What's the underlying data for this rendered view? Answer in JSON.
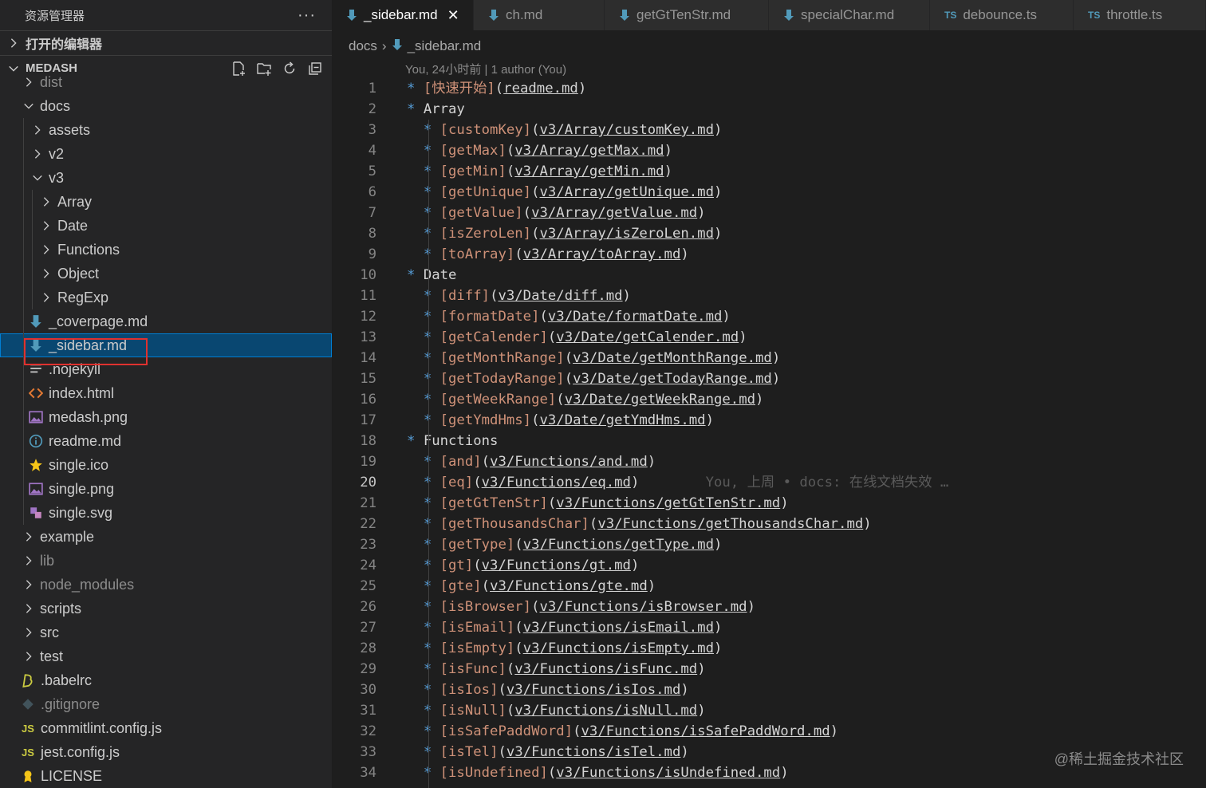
{
  "explorer": {
    "title": "资源管理器",
    "more": "···",
    "open_editors_label": "打开的编辑器",
    "project_label": "MEDASH"
  },
  "tree": [
    {
      "label": "dist",
      "type": "folder",
      "depth": 1,
      "expanded": false,
      "dim": true,
      "icon": "chevron-right-icon"
    },
    {
      "label": "docs",
      "type": "folder",
      "depth": 1,
      "expanded": true,
      "icon": "chevron-down-icon"
    },
    {
      "label": "assets",
      "type": "folder",
      "depth": 2,
      "expanded": false,
      "icon": "chevron-right-icon"
    },
    {
      "label": "v2",
      "type": "folder",
      "depth": 2,
      "expanded": false,
      "icon": "chevron-right-icon"
    },
    {
      "label": "v3",
      "type": "folder",
      "depth": 2,
      "expanded": true,
      "icon": "chevron-down-icon"
    },
    {
      "label": "Array",
      "type": "folder",
      "depth": 3,
      "expanded": false,
      "icon": "chevron-right-icon"
    },
    {
      "label": "Date",
      "type": "folder",
      "depth": 3,
      "expanded": false,
      "icon": "chevron-right-icon"
    },
    {
      "label": "Functions",
      "type": "folder",
      "depth": 3,
      "expanded": false,
      "icon": "chevron-right-icon"
    },
    {
      "label": "Object",
      "type": "folder",
      "depth": 3,
      "expanded": false,
      "icon": "chevron-right-icon"
    },
    {
      "label": "RegExp",
      "type": "folder",
      "depth": 3,
      "expanded": false,
      "icon": "chevron-right-icon"
    },
    {
      "label": "_coverpage.md",
      "type": "file",
      "depth": 2,
      "icon": "markdown-icon"
    },
    {
      "label": "_sidebar.md",
      "type": "file",
      "depth": 2,
      "icon": "markdown-icon",
      "selected": true
    },
    {
      "label": ".nojekyll",
      "type": "file",
      "depth": 2,
      "icon": "text-file-icon"
    },
    {
      "label": "index.html",
      "type": "file",
      "depth": 2,
      "icon": "html-icon"
    },
    {
      "label": "medash.png",
      "type": "file",
      "depth": 2,
      "icon": "image-icon"
    },
    {
      "label": "readme.md",
      "type": "file",
      "depth": 2,
      "icon": "info-icon"
    },
    {
      "label": "single.ico",
      "type": "file",
      "depth": 2,
      "icon": "star-icon"
    },
    {
      "label": "single.png",
      "type": "file",
      "depth": 2,
      "icon": "image-icon"
    },
    {
      "label": "single.svg",
      "type": "file",
      "depth": 2,
      "icon": "svg-icon"
    },
    {
      "label": "example",
      "type": "folder",
      "depth": 1,
      "expanded": false,
      "icon": "chevron-right-icon"
    },
    {
      "label": "lib",
      "type": "folder",
      "depth": 1,
      "expanded": false,
      "dim": true,
      "icon": "chevron-right-icon"
    },
    {
      "label": "node_modules",
      "type": "folder",
      "depth": 1,
      "expanded": false,
      "dim": true,
      "icon": "chevron-right-icon"
    },
    {
      "label": "scripts",
      "type": "folder",
      "depth": 1,
      "expanded": false,
      "icon": "chevron-right-icon"
    },
    {
      "label": "src",
      "type": "folder",
      "depth": 1,
      "expanded": false,
      "icon": "chevron-right-icon"
    },
    {
      "label": "test",
      "type": "folder",
      "depth": 1,
      "expanded": false,
      "icon": "chevron-right-icon"
    },
    {
      "label": ".babelrc",
      "type": "file",
      "depth": 0,
      "icon": "babel-icon"
    },
    {
      "label": ".gitignore",
      "type": "file",
      "depth": 0,
      "dim": true,
      "icon": "git-icon"
    },
    {
      "label": "commitlint.config.js",
      "type": "file",
      "depth": 0,
      "icon": "js-icon"
    },
    {
      "label": "jest.config.js",
      "type": "file",
      "depth": 0,
      "icon": "js-icon"
    },
    {
      "label": "LICENSE",
      "type": "file",
      "depth": 0,
      "icon": "license-icon"
    }
  ],
  "tabs": [
    {
      "label": "_sidebar.md",
      "icon": "markdown-icon",
      "active": true,
      "width": 178
    },
    {
      "label": "ch.md",
      "icon": "markdown-icon",
      "width": 164
    },
    {
      "label": "getGtTenStr.md",
      "icon": "markdown-icon",
      "width": 206
    },
    {
      "label": "specialChar.md",
      "icon": "markdown-icon",
      "width": 202
    },
    {
      "label": "debounce.ts",
      "icon": "ts-icon",
      "width": 180
    },
    {
      "label": "throttle.ts",
      "icon": "ts-icon",
      "width": 166
    }
  ],
  "ts_badge": "TS",
  "js_badge": "JS",
  "close_glyph": "✕",
  "breadcrumb": {
    "folder": "docs",
    "sep": "›",
    "file": "_sidebar.md"
  },
  "blame": "You, 24小时前 | 1 author (You)",
  "current_line": 20,
  "inline_blame": "You, 上周 • docs: 在线文档失效 …",
  "lines": [
    {
      "n": 1,
      "kind": "link",
      "indent": 0,
      "text": "快速开始",
      "url": "readme.md"
    },
    {
      "n": 2,
      "kind": "head",
      "text": "Array"
    },
    {
      "n": 3,
      "kind": "link",
      "indent": 1,
      "text": "customKey",
      "url": "v3/Array/customKey.md"
    },
    {
      "n": 4,
      "kind": "link",
      "indent": 1,
      "text": "getMax",
      "url": "v3/Array/getMax.md"
    },
    {
      "n": 5,
      "kind": "link",
      "indent": 1,
      "text": "getMin",
      "url": "v3/Array/getMin.md"
    },
    {
      "n": 6,
      "kind": "link",
      "indent": 1,
      "text": "getUnique",
      "url": "v3/Array/getUnique.md"
    },
    {
      "n": 7,
      "kind": "link",
      "indent": 1,
      "text": "getValue",
      "url": "v3/Array/getValue.md"
    },
    {
      "n": 8,
      "kind": "link",
      "indent": 1,
      "text": "isZeroLen",
      "url": "v3/Array/isZeroLen.md"
    },
    {
      "n": 9,
      "kind": "link",
      "indent": 1,
      "text": "toArray",
      "url": "v3/Array/toArray.md"
    },
    {
      "n": 10,
      "kind": "head",
      "text": "Date"
    },
    {
      "n": 11,
      "kind": "link",
      "indent": 1,
      "text": "diff",
      "url": "v3/Date/diff.md"
    },
    {
      "n": 12,
      "kind": "link",
      "indent": 1,
      "text": "formatDate",
      "url": "v3/Date/formatDate.md"
    },
    {
      "n": 13,
      "kind": "link",
      "indent": 1,
      "text": "getCalender",
      "url": "v3/Date/getCalender.md"
    },
    {
      "n": 14,
      "kind": "link",
      "indent": 1,
      "text": "getMonthRange",
      "url": "v3/Date/getMonthRange.md"
    },
    {
      "n": 15,
      "kind": "link",
      "indent": 1,
      "text": "getTodayRange",
      "url": "v3/Date/getTodayRange.md"
    },
    {
      "n": 16,
      "kind": "link",
      "indent": 1,
      "text": "getWeekRange",
      "url": "v3/Date/getWeekRange.md"
    },
    {
      "n": 17,
      "kind": "link",
      "indent": 1,
      "text": "getYmdHms",
      "url": "v3/Date/getYmdHms.md"
    },
    {
      "n": 18,
      "kind": "head",
      "text": "Functions"
    },
    {
      "n": 19,
      "kind": "link",
      "indent": 1,
      "text": "and",
      "url": "v3/Functions/and.md"
    },
    {
      "n": 20,
      "kind": "link",
      "indent": 1,
      "text": "eq",
      "url": "v3/Functions/eq.md"
    },
    {
      "n": 21,
      "kind": "link",
      "indent": 1,
      "text": "getGtTenStr",
      "url": "v3/Functions/getGtTenStr.md"
    },
    {
      "n": 22,
      "kind": "link",
      "indent": 1,
      "text": "getThousandsChar",
      "url": "v3/Functions/getThousandsChar.md"
    },
    {
      "n": 23,
      "kind": "link",
      "indent": 1,
      "text": "getType",
      "url": "v3/Functions/getType.md"
    },
    {
      "n": 24,
      "kind": "link",
      "indent": 1,
      "text": "gt",
      "url": "v3/Functions/gt.md"
    },
    {
      "n": 25,
      "kind": "link",
      "indent": 1,
      "text": "gte",
      "url": "v3/Functions/gte.md"
    },
    {
      "n": 26,
      "kind": "link",
      "indent": 1,
      "text": "isBrowser",
      "url": "v3/Functions/isBrowser.md"
    },
    {
      "n": 27,
      "kind": "link",
      "indent": 1,
      "text": "isEmail",
      "url": "v3/Functions/isEmail.md"
    },
    {
      "n": 28,
      "kind": "link",
      "indent": 1,
      "text": "isEmpty",
      "url": "v3/Functions/isEmpty.md"
    },
    {
      "n": 29,
      "kind": "link",
      "indent": 1,
      "text": "isFunc",
      "url": "v3/Functions/isFunc.md"
    },
    {
      "n": 30,
      "kind": "link",
      "indent": 1,
      "text": "isIos",
      "url": "v3/Functions/isIos.md"
    },
    {
      "n": 31,
      "kind": "link",
      "indent": 1,
      "text": "isNull",
      "url": "v3/Functions/isNull.md"
    },
    {
      "n": 32,
      "kind": "link",
      "indent": 1,
      "text": "isSafePaddWord",
      "url": "v3/Functions/isSafePaddWord.md"
    },
    {
      "n": 33,
      "kind": "link",
      "indent": 1,
      "text": "isTel",
      "url": "v3/Functions/isTel.md"
    },
    {
      "n": 34,
      "kind": "link",
      "indent": 1,
      "text": "isUndefined",
      "url": "v3/Functions/isUndefined.md"
    }
  ],
  "watermark": "@稀土掘金技术社区",
  "colors": {
    "accent": "#007fd4",
    "selection": "#094771",
    "highlight_box": "#e0312f",
    "markdown_icon": "#519aba",
    "ts_icon": "#519aba",
    "js_icon": "#cbcb41",
    "html_icon": "#e37933",
    "star_icon": "#f5c518",
    "svg_icon": "#a074c4"
  }
}
